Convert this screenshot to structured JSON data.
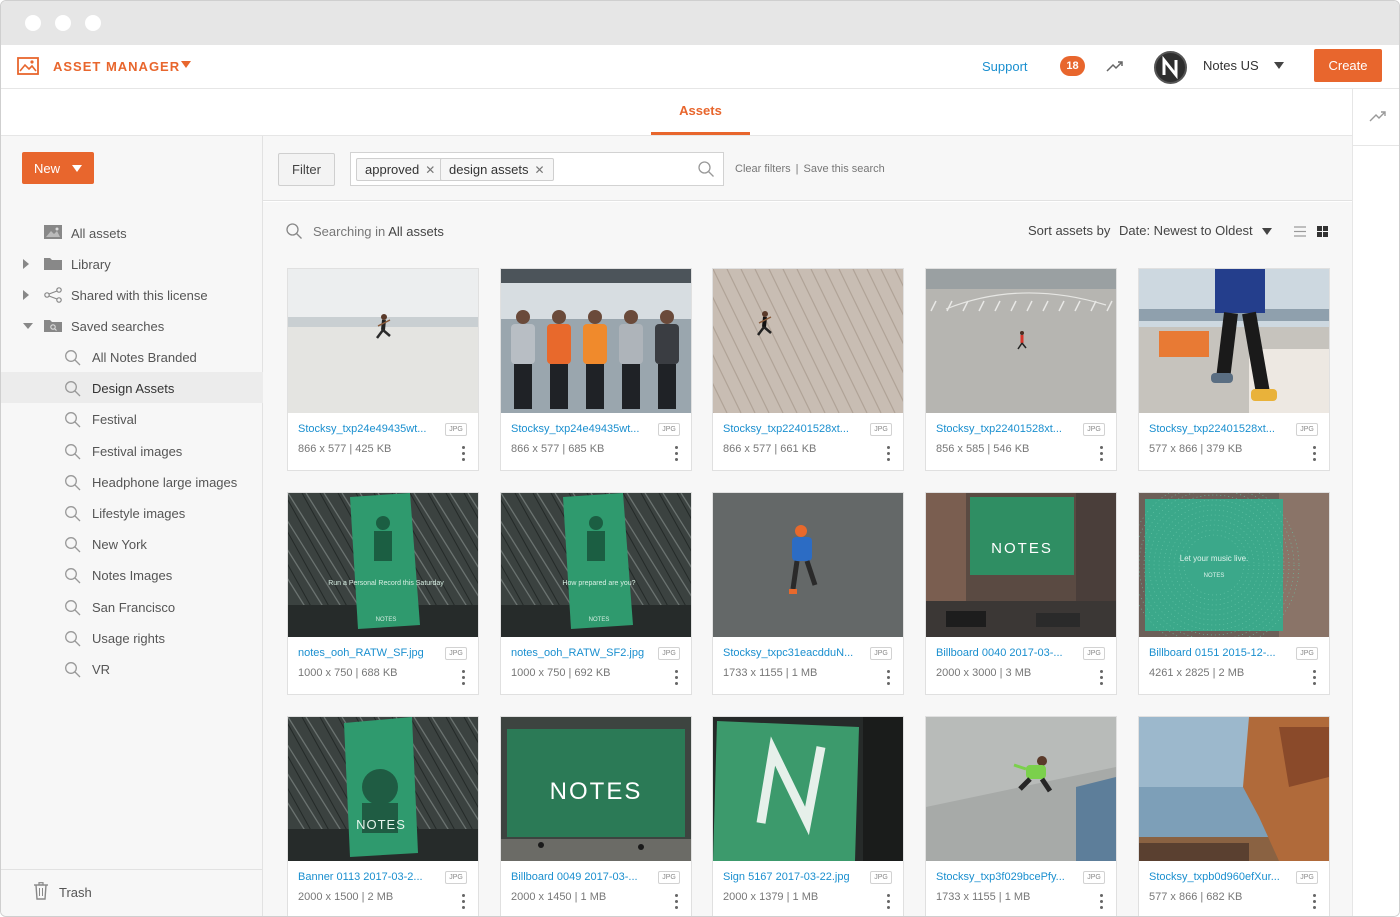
{
  "app": {
    "brand": "ASSET MANAGER",
    "support_label": "Support",
    "notification_count": "18",
    "account_name": "Notes US",
    "create_label": "Create",
    "accent_color": "#e8662d",
    "link_color": "#1a8fcf"
  },
  "tabs": [
    {
      "label": "Assets",
      "active": true
    }
  ],
  "sidebar": {
    "new_label": "New",
    "items": [
      {
        "label": "All assets",
        "icon": "image-icon"
      },
      {
        "label": "Library",
        "icon": "folder-icon",
        "expandable": true
      },
      {
        "label": "Shared with this license",
        "icon": "share-icon",
        "expandable": true
      },
      {
        "label": "Saved searches",
        "icon": "saved-search-folder-icon",
        "expanded": true
      }
    ],
    "saved_searches": [
      "All Notes Branded",
      "Design Assets",
      "Festival",
      "Festival images",
      "Headphone large images",
      "Lifestyle images",
      "New York",
      "Notes Images",
      "San Francisco",
      "Usage rights",
      "VR"
    ],
    "active_saved_search": "Design Assets",
    "trash_label": "Trash"
  },
  "filters": {
    "filter_label": "Filter",
    "chips": [
      "approved",
      "design assets"
    ],
    "clear_label": "Clear filters",
    "separator": "|",
    "save_label": "Save this search"
  },
  "results": {
    "searching_prefix": "Searching in",
    "searching_scope": "All assets",
    "sort_label": "Sort assets by",
    "sort_value": "Date: Newest to Oldest"
  },
  "assets": [
    {
      "name": "Stocksy_txp24e49435wt...",
      "type": "JPG",
      "meta": "866 x 577 | 425 KB",
      "scene": "beach-run"
    },
    {
      "name": "Stocksy_txp24e49435wt...",
      "type": "JPG",
      "meta": "866 x 577 | 685 KB",
      "scene": "group"
    },
    {
      "name": "Stocksy_txp22401528xt...",
      "type": "JPG",
      "meta": "866 x 577 | 661 KB",
      "scene": "steps"
    },
    {
      "name": "Stocksy_txp22401528xt...",
      "type": "JPG",
      "meta": "856 x 585 | 546 KB",
      "scene": "lot"
    },
    {
      "name": "Stocksy_txp22401528xt...",
      "type": "JPG",
      "meta": "577 x 866 | 379 KB",
      "scene": "legs"
    },
    {
      "name": "notes_ooh_RATW_SF.jpg",
      "type": "JPG",
      "meta": "1000 x 750 | 688 KB",
      "scene": "banner",
      "banner_text": "Run a Personal Record this Saturday"
    },
    {
      "name": "notes_ooh_RATW_SF2.jpg",
      "type": "JPG",
      "meta": "1000 x 750 | 692 KB",
      "scene": "banner",
      "banner_text": "How prepared are you?"
    },
    {
      "name": "Stocksy_txpc31eacdduN...",
      "type": "JPG",
      "meta": "1733 x 1155 | 1 MB",
      "scene": "road-run"
    },
    {
      "name": "Billboard 0040 2017-03-...",
      "type": "JPG",
      "meta": "2000 x 3000 | 3 MB",
      "scene": "billboard-notes",
      "banner_text": "NOTES"
    },
    {
      "name": "Billboard 0151 2015-12-...",
      "type": "JPG",
      "meta": "4261 x 2825 | 2 MB",
      "scene": "billboard-music",
      "banner_text": "Let your music live."
    },
    {
      "name": "Banner 0113 2017-03-2...",
      "type": "JPG",
      "meta": "2000 x 1500 | 2 MB",
      "scene": "banner-notes",
      "banner_text": "NOTES"
    },
    {
      "name": "Billboard 0049 2017-03-...",
      "type": "JPG",
      "meta": "2000 x 1450 | 1 MB",
      "scene": "wall-notes",
      "banner_text": "NOTES"
    },
    {
      "name": "Sign 5167 2017-03-22.jpg",
      "type": "JPG",
      "meta": "2000 x 1379 | 1 MB",
      "scene": "sign-n"
    },
    {
      "name": "Stocksy_txp3f029bcePfy...",
      "type": "JPG",
      "meta": "1733 x 1155 | 1 MB",
      "scene": "jump"
    },
    {
      "name": "Stocksy_txpb0d960efXur...",
      "type": "JPG",
      "meta": "577 x 866 | 682 KB",
      "scene": "rocks"
    }
  ]
}
